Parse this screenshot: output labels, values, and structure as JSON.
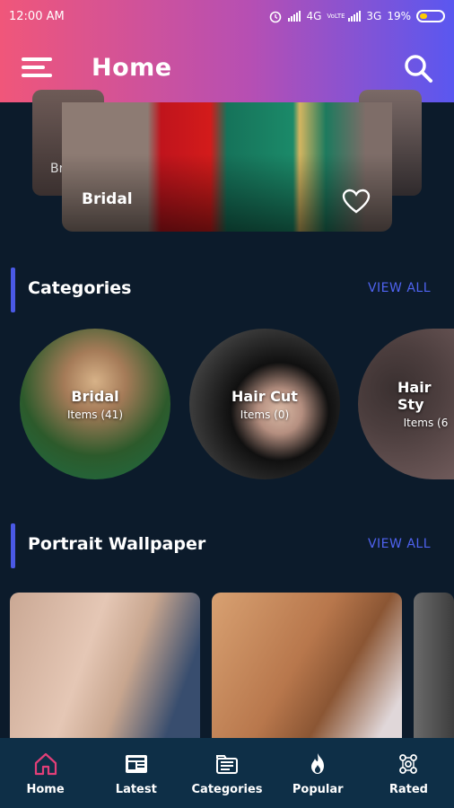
{
  "status_bar": {
    "time": "12:00 AM",
    "network1": "4G",
    "network1_badge": "VoLTE",
    "network2": "3G",
    "battery": "19%"
  },
  "header": {
    "title": "Home"
  },
  "slider": {
    "main_label": "Bridal",
    "back_label": "Br"
  },
  "categories_section": {
    "title": "Categories",
    "view_all": "VIEW ALL",
    "items": [
      {
        "name": "Bridal",
        "count": "Items (41)"
      },
      {
        "name": "Hair Cut",
        "count": "Items (0)"
      },
      {
        "name": "Hair Sty",
        "count": "Items (6"
      }
    ]
  },
  "portrait_section": {
    "title": "Portrait Wallpaper",
    "view_all": "VIEW ALL"
  },
  "bottom_nav": {
    "items": [
      {
        "label": "Home",
        "icon": "home-icon"
      },
      {
        "label": "Latest",
        "icon": "latest-icon"
      },
      {
        "label": "Categories",
        "icon": "categories-icon"
      },
      {
        "label": "Popular",
        "icon": "fire-icon"
      },
      {
        "label": "Rated",
        "icon": "rated-icon"
      }
    ],
    "active_index": 0
  },
  "colors": {
    "background": "#0c1b2b",
    "accent": "#4a59e5",
    "nav_bg": "#0e2f47",
    "active_icon": "#e23f78"
  }
}
